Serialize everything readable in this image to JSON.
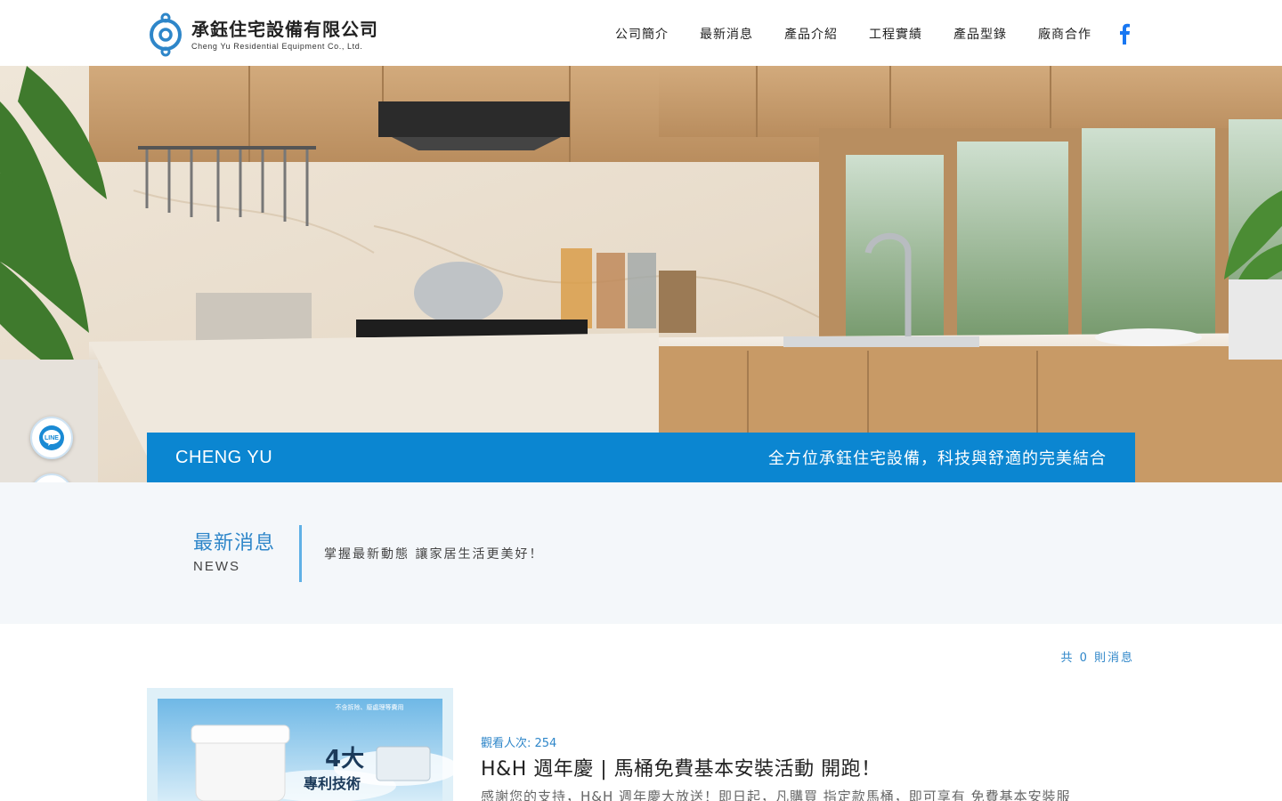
{
  "header": {
    "company_cn": "承鈺住宅設備有限公司",
    "company_en": "Cheng Yu Residential Equipment Co., Ltd.",
    "nav": [
      "公司簡介",
      "最新消息",
      "產品介紹",
      "工程實績",
      "產品型錄",
      "廠商合作"
    ],
    "social_icon": "facebook-icon",
    "brand_color": "#2e86c9"
  },
  "hero": {
    "band_left": "CHENG YU",
    "band_right": "全方位承鈺住宅設備，科技與舒適的完美結合",
    "band_color": "#0b86d1",
    "float_buttons": [
      {
        "icon": "line-icon",
        "label": "LINE"
      },
      {
        "icon": "messenger-icon"
      }
    ]
  },
  "news": {
    "title_cn": "最新消息",
    "title_en": "NEWS",
    "subtitle": "掌握最新動態 讓家居生活更美好！"
  },
  "list": {
    "count_text": "共 0 則消息",
    "articles": [
      {
        "views": "觀看人次: 254",
        "title": "H&H 週年慶 | 馬桶免費基本安裝活動 開跑！",
        "excerpt": "感謝您的支持，H&H 週年慶大放送！即日起，凡購買 指定款馬桶，即可享有 免費基本安裝服",
        "thumb_text_top": "不含拆除、廢處理等費用",
        "thumb_text_big": "4大",
        "thumb_text_sub": "專利技術"
      }
    ]
  }
}
